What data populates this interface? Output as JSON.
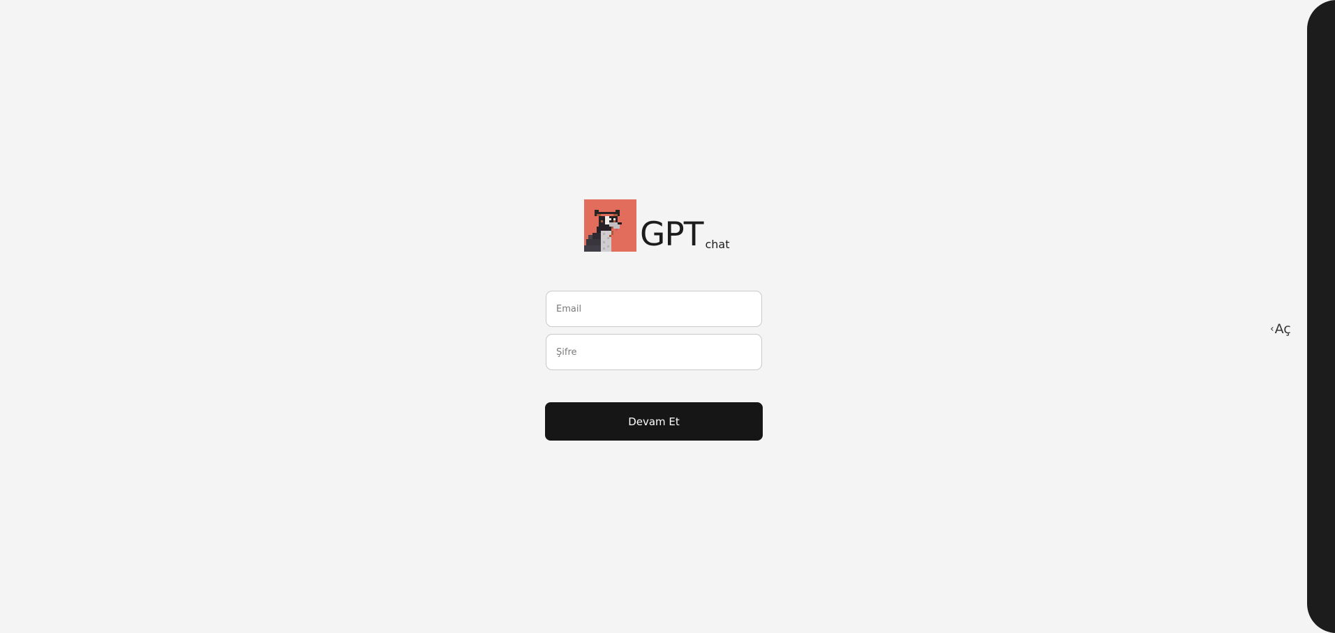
{
  "brand": {
    "logo_icon": "pixel-dog-logo-icon",
    "logo_color": "#e36d5d",
    "title": "GPT",
    "subtitle": "chat"
  },
  "form": {
    "email_placeholder": "Email",
    "password_placeholder": "Şifre",
    "submit_label": "Devam Et",
    "submit_color": "#161616"
  },
  "sidebar": {
    "toggle_icon": "chevron-left-icon",
    "toggle_chevron": "‹",
    "toggle_label": "Aç",
    "panel_color": "#1c1c1c"
  }
}
